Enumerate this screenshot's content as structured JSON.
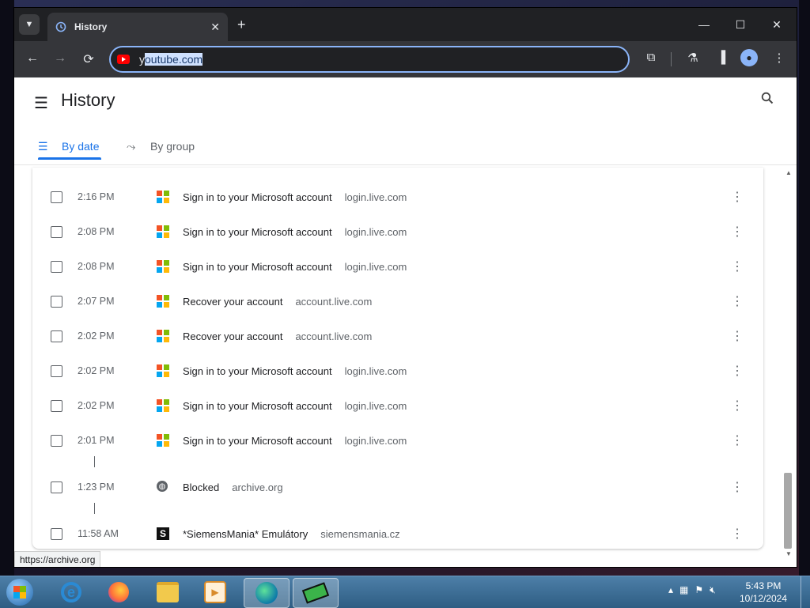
{
  "browser": {
    "tab_title": "History",
    "tab_close": "✕",
    "new_tab": "+",
    "omnibox_prefix": "y",
    "omnibox_selected": "outube.com",
    "window_controls": {
      "minimize": "—",
      "maximize": "☐",
      "close": "✕"
    }
  },
  "page": {
    "title": "History",
    "tabs": [
      {
        "label": "By date",
        "active": true
      },
      {
        "label": "By group",
        "active": false
      }
    ]
  },
  "history": [
    {
      "time": "2:16 PM",
      "title": "Sign in to your Microsoft account",
      "domain": "login.live.com",
      "favicon": "microsoft"
    },
    {
      "time": "2:08 PM",
      "title": "Sign in to your Microsoft account",
      "domain": "login.live.com",
      "favicon": "microsoft"
    },
    {
      "time": "2:08 PM",
      "title": "Sign in to your Microsoft account",
      "domain": "login.live.com",
      "favicon": "microsoft"
    },
    {
      "time": "2:07 PM",
      "title": "Recover your account",
      "domain": "account.live.com",
      "favicon": "microsoft"
    },
    {
      "time": "2:02 PM",
      "title": "Recover your account",
      "domain": "account.live.com",
      "favicon": "microsoft"
    },
    {
      "time": "2:02 PM",
      "title": "Sign in to your Microsoft account",
      "domain": "login.live.com",
      "favicon": "microsoft"
    },
    {
      "time": "2:02 PM",
      "title": "Sign in to your Microsoft account",
      "domain": "login.live.com",
      "favicon": "microsoft"
    },
    {
      "time": "2:01 PM",
      "title": "Sign in to your Microsoft account",
      "domain": "login.live.com",
      "favicon": "microsoft"
    },
    {
      "time": "1:23 PM",
      "title": "Blocked",
      "domain": "archive.org",
      "favicon": "globe"
    },
    {
      "time": "11:58 AM",
      "title": "*SiemensMania* Emulátory",
      "domain": "siemensmania.cz",
      "favicon": "siemensmania"
    }
  ],
  "status_url": "https://archive.org",
  "taskbar": {
    "time": "5:43 PM",
    "date": "10/12/2024"
  },
  "colors": {
    "accent": "#1a73e8",
    "omnibox_border": "#8ab4f8",
    "ms_red": "#f35325",
    "ms_green": "#81bc06",
    "ms_blue": "#05a6f0",
    "ms_yellow": "#ffba08"
  }
}
